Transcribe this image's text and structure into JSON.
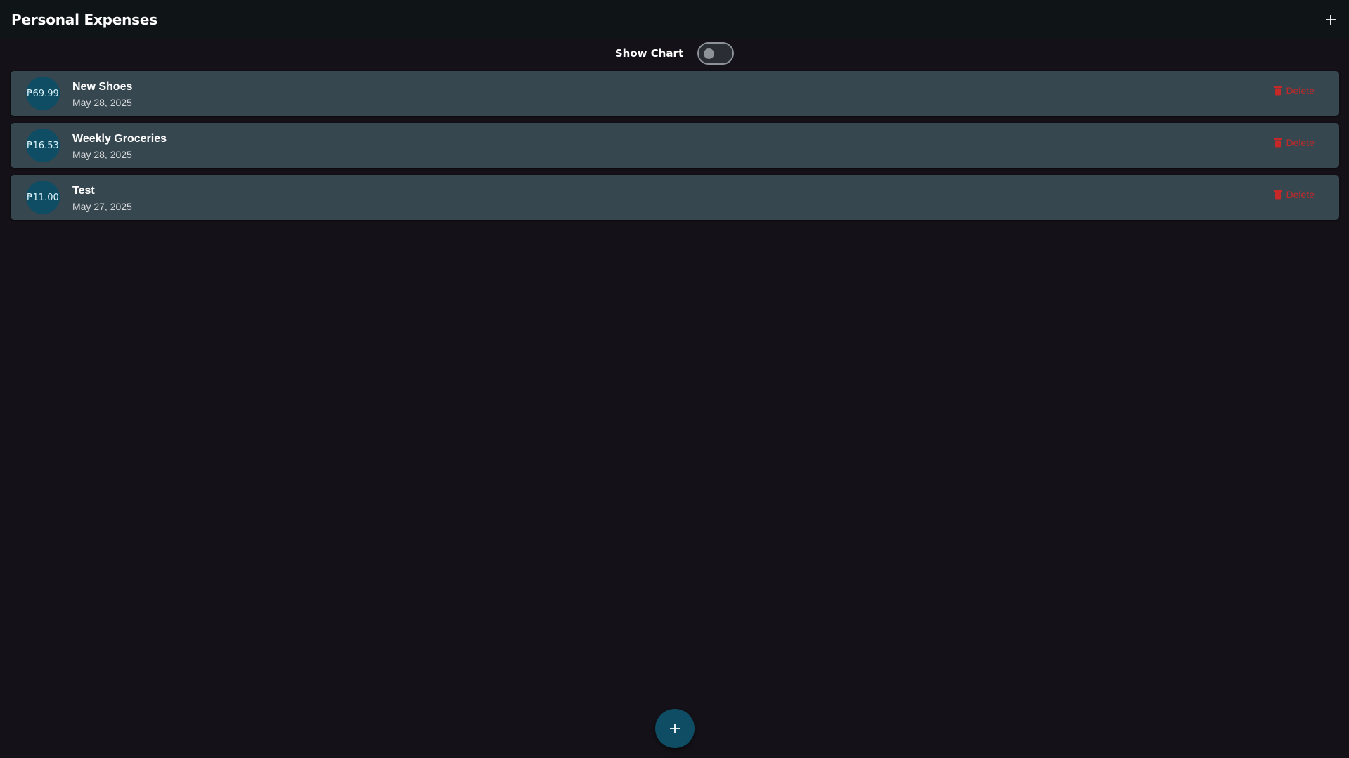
{
  "app_bar": {
    "title": "Personal Expenses",
    "add_icon": "plus-icon"
  },
  "chart_toggle": {
    "label": "Show Chart",
    "enabled": false
  },
  "expenses": [
    {
      "amount": "₱69.99",
      "title": "New Shoes",
      "date": "May 28, 2025",
      "delete_label": "Delete"
    },
    {
      "amount": "₱16.53",
      "title": "Weekly Groceries",
      "date": "May 28, 2025",
      "delete_label": "Delete"
    },
    {
      "amount": "₱11.00",
      "title": "Test",
      "date": "May 27, 2025",
      "delete_label": "Delete"
    }
  ],
  "fab": {
    "icon": "plus-icon"
  },
  "colors": {
    "background": "#141218",
    "app_bar": "#0f1417",
    "card": "#37474f",
    "avatar": "#0e4d64",
    "delete": "#c62828",
    "fab": "#0e4d64"
  }
}
